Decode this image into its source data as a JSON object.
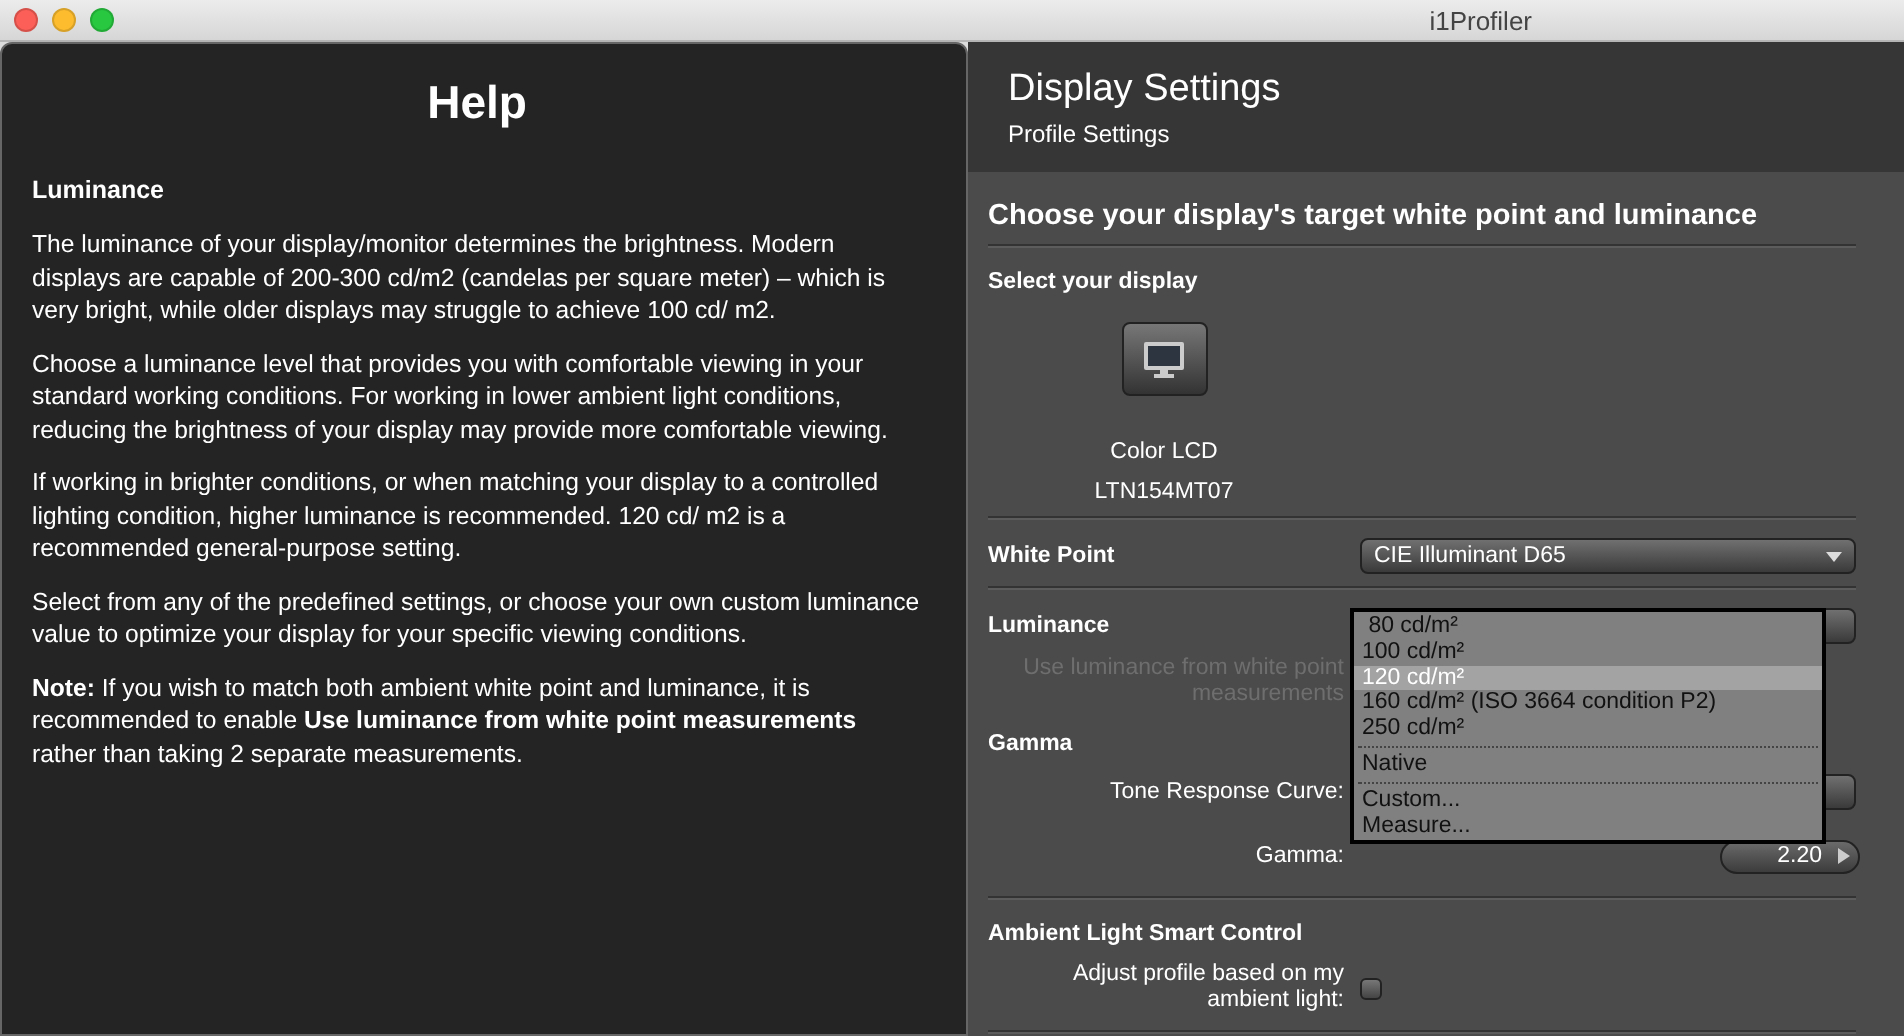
{
  "window": {
    "title": "i1Profiler"
  },
  "help": {
    "title": "Help",
    "heading": "Luminance",
    "paragraphs": [
      "The luminance of your display/monitor determines the brightness. Modern displays are capable of 200-300 cd/m2 (candelas per square meter) – which is very bright, while older displays may struggle to achieve 100 cd/ m2.",
      "Choose a luminance level that provides you with comfortable viewing in your standard working conditions. For working in lower ambient light conditions, reducing the brightness of your display may provide more comfortable viewing.",
      "If working in brighter conditions, or when matching your display to a controlled lighting condition, higher luminance is recommended. 120 cd/ m2 is a recommended general-purpose setting.",
      "Select from any of the predefined settings, or choose your own custom luminance value to optimize your display for your specific viewing conditions.",
      "**Note:** If you wish to match both ambient white point and luminance, it is recommended to enable **Use luminance from white point measurements** rather than taking 2 separate measurements."
    ]
  },
  "header": {
    "title": "Display Settings",
    "subtitle": "Profile Settings"
  },
  "section_title": "Choose your display's target white point and luminance",
  "display": {
    "heading": "Select your display",
    "name": "Color LCD",
    "model": "LTN154MT07"
  },
  "white_point": {
    "label": "White Point",
    "value": "CIE Illuminant D65"
  },
  "luminance": {
    "label": "Luminance",
    "option_label": "Use luminance from white point measurements",
    "disabled": true,
    "menu": [
      [
        {
          "label": " 80 cd/m²",
          "selected": false
        },
        {
          "label": "100 cd/m²",
          "selected": false
        },
        {
          "label": "120 cd/m²",
          "selected": true
        },
        {
          "label": "160 cd/m² (ISO 3664 condition P2)",
          "selected": false
        },
        {
          "label": "250 cd/m²",
          "selected": false
        }
      ],
      [
        {
          "label": "Native",
          "selected": false
        }
      ],
      [
        {
          "label": "Custom...",
          "selected": false
        },
        {
          "label": "Measure...",
          "selected": false
        }
      ]
    ]
  },
  "gamma": {
    "heading": "Gamma",
    "curve_label": "Tone Response Curve:",
    "gamma_label": "Gamma:",
    "gamma_value": "2.20"
  },
  "ambient": {
    "heading": "Ambient Light Smart Control",
    "label": "Adjust profile based on my ambient light:",
    "checked": false
  }
}
